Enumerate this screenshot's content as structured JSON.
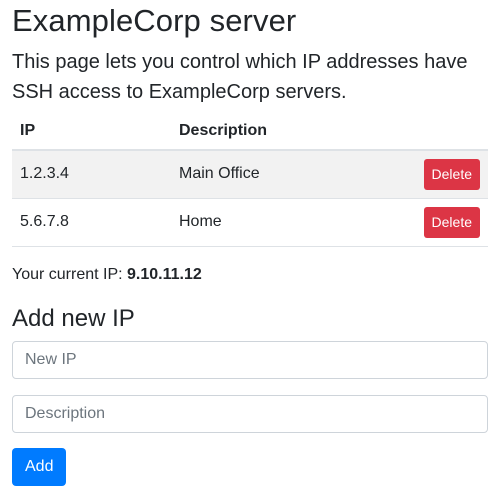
{
  "page": {
    "title": "ExampleCorp server",
    "intro": "This page lets you control which IP addresses have SSH access to ExampleCorp servers."
  },
  "table": {
    "headers": {
      "ip": "IP",
      "description": "Description"
    },
    "rows": [
      {
        "ip": "1.2.3.4",
        "description": "Main Office",
        "action_label": "Delete"
      },
      {
        "ip": "5.6.7.8",
        "description": "Home",
        "action_label": "Delete"
      }
    ]
  },
  "current_ip": {
    "label": "Your current IP:",
    "value": "9.10.11.12"
  },
  "add_section": {
    "title": "Add new IP",
    "new_ip_placeholder": "New IP",
    "description_placeholder": "Description",
    "add_label": "Add"
  },
  "colors": {
    "delete_button": "#dc3545",
    "add_button": "#007bff",
    "striped_row": "#f2f2f2"
  }
}
